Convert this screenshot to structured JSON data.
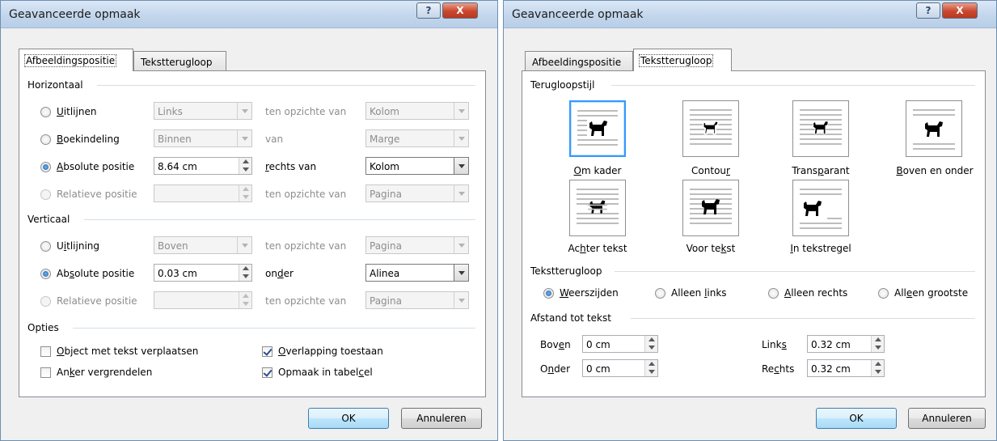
{
  "left_dialog": {
    "title": "Geavanceerde opmaak",
    "help_label": "?",
    "close_label": "X",
    "tabs": [
      "Afbeeldingspositie",
      "Tekstterugloop"
    ],
    "horizontal": {
      "heading": "Horizontaal",
      "rows": [
        {
          "label_pre": "",
          "label_key": "U",
          "label_post": "itlijnen",
          "value": "Links",
          "relation": "ten opzichte van",
          "relative_to": "Kolom"
        },
        {
          "label_pre": "",
          "label_key": "B",
          "label_post": "oekindeling",
          "value": "Binnen",
          "relation": "van",
          "relative_to": "Marge"
        },
        {
          "label_pre": "",
          "label_key": "A",
          "label_post": "bsolute positie",
          "value": "8.64 cm",
          "relation_pre": "",
          "relation_key": "r",
          "relation_post": "echts van",
          "relative_to": "Kolom"
        },
        {
          "label_pre": "Relatieve positie",
          "value": "",
          "relation": "ten opzichte van",
          "relative_to": "Pagina"
        }
      ]
    },
    "vertical": {
      "heading": "Verticaal",
      "rows": [
        {
          "label_pre": "U",
          "label_key": "i",
          "label_post": "tlijning",
          "value": "Boven",
          "relation": "ten opzichte van",
          "relative_to": "Pagina"
        },
        {
          "label_pre": "Ab",
          "label_key": "s",
          "label_post": "olute positie",
          "value": "0.03 cm",
          "relation_pre": "on",
          "relation_key": "d",
          "relation_post": "er",
          "relative_to": "Alinea"
        },
        {
          "label_pre": "Relatieve positie",
          "value": "",
          "relation": "ten opzichte van",
          "relative_to": "Pagina"
        }
      ]
    },
    "options": {
      "heading": "Opties",
      "items": [
        {
          "pre": "",
          "key": "O",
          "post": "bject met tekst verplaatsen",
          "checked": false
        },
        {
          "pre": "An",
          "key": "k",
          "post": "er vergrendelen",
          "checked": false
        },
        {
          "pre": "",
          "key": "O",
          "post": "verlapping toestaan",
          "checked": true
        },
        {
          "pre": "Opmaak in tabel",
          "key": "c",
          "post": "el",
          "checked": true
        }
      ]
    },
    "ok_label": "OK",
    "cancel_label": "Annuleren"
  },
  "right_dialog": {
    "title": "Geavanceerde opmaak",
    "help_label": "?",
    "close_label": "X",
    "tabs": [
      "Afbeeldingspositie",
      "Tekstterugloop"
    ],
    "wrap_style": {
      "heading": "Terugloopstijl",
      "styles": [
        {
          "pre": "",
          "key": "O",
          "post": "m kader",
          "selected": true,
          "icon": "square-wrap-icon"
        },
        {
          "pre": "Contou",
          "key": "r",
          "post": "",
          "selected": false,
          "icon": "tight-wrap-icon"
        },
        {
          "pre": "Trans",
          "key": "p",
          "post": "arant",
          "selected": false,
          "icon": "through-wrap-icon"
        },
        {
          "pre": "",
          "key": "B",
          "post": "oven en onder",
          "selected": false,
          "icon": "top-bottom-wrap-icon"
        },
        {
          "pre": "Ac",
          "key": "h",
          "post": "ter tekst",
          "selected": false,
          "icon": "behind-text-icon"
        },
        {
          "pre": "Voor te",
          "key": "k",
          "post": "st",
          "selected": false,
          "icon": "in-front-text-icon"
        },
        {
          "pre": "",
          "key": "I",
          "post": "n tekstregel",
          "selected": false,
          "icon": "inline-text-icon"
        }
      ]
    },
    "wrap_text": {
      "heading": "Tekstterugloop",
      "options": [
        {
          "pre": "",
          "key": "W",
          "post": "eerszijden",
          "selected": true
        },
        {
          "pre": "Alleen ",
          "key": "l",
          "post": "inks",
          "selected": false
        },
        {
          "pre": "",
          "key": "A",
          "post": "lleen rechts",
          "selected": false
        },
        {
          "pre": "All",
          "key": "e",
          "post": "en grootste",
          "selected": false
        }
      ]
    },
    "distance": {
      "heading": "Afstand tot tekst",
      "top": {
        "pre": "Bov",
        "key": "e",
        "post": "n",
        "value": "0 cm"
      },
      "bottom": {
        "pre": "O",
        "key": "n",
        "post": "der",
        "value": "0 cm"
      },
      "left": {
        "pre": "Link",
        "key": "s",
        "post": "",
        "value": "0.32 cm"
      },
      "right": {
        "pre": "Re",
        "key": "c",
        "post": "hts",
        "value": "0.32 cm"
      }
    },
    "ok_label": "OK",
    "cancel_label": "Annuleren"
  }
}
